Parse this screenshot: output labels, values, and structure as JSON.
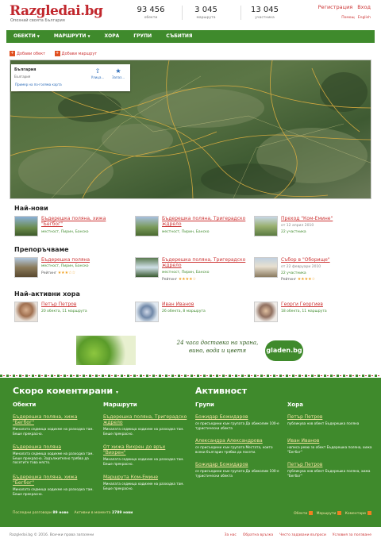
{
  "header": {
    "logo": "Razgledai.bg",
    "tagline": "Опознай своята България",
    "stats": [
      {
        "value": "93 456",
        "label": "обекти"
      },
      {
        "value": "3 045",
        "label": "маршрута"
      },
      {
        "value": "13 045",
        "label": "участника"
      }
    ],
    "register": "Регистрация",
    "login": "Вход",
    "help": "Помощ",
    "english": "English"
  },
  "nav": {
    "items": [
      "ОБЕКТИ",
      "МАРШРУТИ",
      "ХОРА",
      "ГРУПИ",
      "СЪБИТИЯ"
    ],
    "search_placeholder": "",
    "search_icon": "search-icon"
  },
  "actions": {
    "add_object": "Добави обект",
    "add_route": "Добави маршрут"
  },
  "map": {
    "region": "България",
    "region_sub": "България",
    "example": "Пример на по-голяма карта",
    "btn1": "Улица...",
    "btn2": "Запаз..."
  },
  "newest": {
    "title": "Най-нови",
    "items": [
      {
        "title": "Бъдерешка поляна, хижа \"Бегбог\"",
        "tags": "местност, Пирин, Банско"
      },
      {
        "title": "Бъдерешка поляна, Тригерадско ждрело",
        "tags": "местност, Пирин, Банско"
      },
      {
        "title": "Преход \"Ком-Емине\"",
        "date": "от 12 април 2010",
        "who": "22 участника"
      }
    ]
  },
  "recommended": {
    "title": "Препоръчваме",
    "items": [
      {
        "title": "Бъдерешка поляна",
        "tags": "местност, Пирин, Банско",
        "rating_label": "Рейтинг",
        "rating": 3
      },
      {
        "title": "Бъдерешка поляна, Тригерадско ждрело",
        "tags": "местност, Пирин, Банско",
        "rating_label": "Рейтинг",
        "rating": 4
      },
      {
        "title": "Събор в \"Оборище\"",
        "date": "от 22 февруари 2010",
        "who": "22 участника",
        "rating_label": "Рейтинг",
        "rating": 4
      }
    ]
  },
  "active": {
    "title": "Най-активни хора",
    "items": [
      {
        "name": "Петър Петров",
        "stats": "20 обекта, 11 маршрута"
      },
      {
        "name": "Иван Иванов",
        "stats": "26 обекта, 8 маршрута"
      },
      {
        "name": "Георги Георгиев",
        "stats": "18 обекта, 11 маршрута"
      }
    ]
  },
  "banner": {
    "text": "24 часа доставка на храна, вино, вода и цветя",
    "brand": "gladen.bg"
  },
  "comments": {
    "title": "Скоро коментирани",
    "col_objects": "Обекти",
    "col_routes": "Маршрути",
    "objects": [
      {
        "title": "Бъдерешка поляна, хижа \"Бегбог\"",
        "desc": "Миналата седмица ходихме на разходка там. Беше прекрасно."
      },
      {
        "title": "Бъдерешка поляна",
        "desc": "Миналата седмица ходихме на разходка там. Беше прекрасно. Задължително трябва да посетите това място."
      },
      {
        "title": "Бъдерешка поляна, хижа \"Бегбог\"",
        "desc": "Миналата седмица ходихме на разходка там. Беше прекрасно."
      }
    ],
    "routes": [
      {
        "title": "Бъдерешка поляна, Тригерадско ждрело",
        "desc": "Миналата седмица ходихме на разходка там. Беше прекрасно."
      },
      {
        "title": "От хижа Вихрен до връх \"Вихрен\"",
        "desc": "Миналата седмица ходихме на разходка там. Беше прекрасно."
      },
      {
        "title": "Маршрута Ком-Емине",
        "desc": "Миналата седмица ходихме на разходка там. Беше прекрасно."
      }
    ],
    "footer_last": "Последни разговори",
    "footer_last_count": "89 ново",
    "footer_active": "Активни в момента",
    "footer_active_count": "2789 нови"
  },
  "activity": {
    "title": "Активност",
    "col_groups": "Групи",
    "col_people": "Хора",
    "groups": [
      {
        "name": "Божидар Божидаров",
        "desc": "се присъедини към групата Да обиколим 100-е туристически обекта"
      },
      {
        "name": "Александра Александрова",
        "desc": "се присъедини към групата Местата, които всеки българин трябва да посети."
      },
      {
        "name": "Божидар Божидаров",
        "desc": "се присъедини към групата Да обиколим 100-е туристически обекта"
      }
    ],
    "people": [
      {
        "name": "Петър Петров",
        "desc": "публикува нов обект Бъдерешка поляна"
      },
      {
        "name": "Иван Иванов",
        "desc": "написа ревю за обект Бъдерешка поляна, хижа \"Бегбог\""
      },
      {
        "name": "Петър Петров",
        "desc": "публикува нов обект Бъдерешка поляна, хижа \"Бегбог\""
      }
    ],
    "footer_objects": "Обекти",
    "footer_routes": "Маршрути",
    "footer_comments": "Коментари"
  },
  "footer": {
    "copyright": "Razgledai.bg © 2016. Всички права запазени",
    "links": [
      "За нас",
      "Обратна връзка",
      "Често задавани въпроси",
      "Условия за ползване"
    ]
  },
  "colors": {
    "brand_red": "#c1272d",
    "brand_green": "#3f8a2c",
    "link_yellow": "#f3e3a0"
  }
}
